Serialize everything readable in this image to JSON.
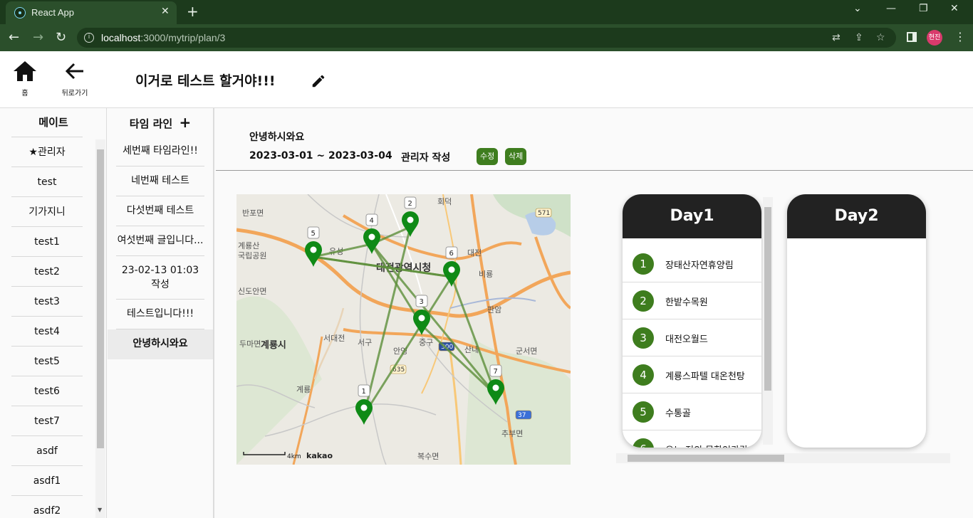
{
  "browser": {
    "tab_title": "React App",
    "url_host": "localhost",
    "url_rest": ":3000/mytrip/plan/3",
    "profile": "현진"
  },
  "header": {
    "home_label": "홈",
    "back_label": "뒤로가기",
    "title": "이거로 테스트 할거야!!!"
  },
  "mates": {
    "title": "메이트",
    "items": [
      "관리자",
      "test",
      "기가지니",
      "test1",
      "test2",
      "test3",
      "test4",
      "test5",
      "test6",
      "test7",
      "asdf",
      "asdf1",
      "asdf2"
    ]
  },
  "timeline": {
    "title": "타임 라인",
    "items": [
      "세번째 타임라인!!",
      "네번째 테스트",
      "다섯번째 테스트",
      "여섯번째 글입니다...",
      "23-02-13 01:03 작성",
      "테스트입니다!!!",
      "안녕하시와요"
    ]
  },
  "plan": {
    "title": "안녕하시와요",
    "dates": "2023-03-01 ~ 2023-03-04",
    "author": "관리자 작성",
    "edit_label": "수정",
    "delete_label": "삭제"
  },
  "map": {
    "labels": [
      "반포면",
      "계룡산",
      "국립공원",
      "유성",
      "대전광역시청",
      "대전",
      "비룡",
      "신도안면",
      "판암",
      "서대전",
      "서구",
      "중구",
      "산내",
      "계룡시",
      "안영",
      "군서면",
      "계룡",
      "두마면",
      "추부면",
      "복수면",
      "회덕"
    ],
    "road_numbers": [
      "571",
      "635",
      "300",
      "37"
    ],
    "scale": "4km",
    "attribution": "kakao",
    "markers": [
      "1",
      "2",
      "3",
      "4",
      "5",
      "6",
      "7"
    ]
  },
  "days": [
    {
      "label": "Day1",
      "stops": [
        "장태산자연휴양림",
        "한밭수목원",
        "대전오월드",
        "계룡스파텔 대온천탕",
        "수통골",
        "오노 전의 목학인카각"
      ]
    },
    {
      "label": "Day2",
      "stops": []
    }
  ]
}
